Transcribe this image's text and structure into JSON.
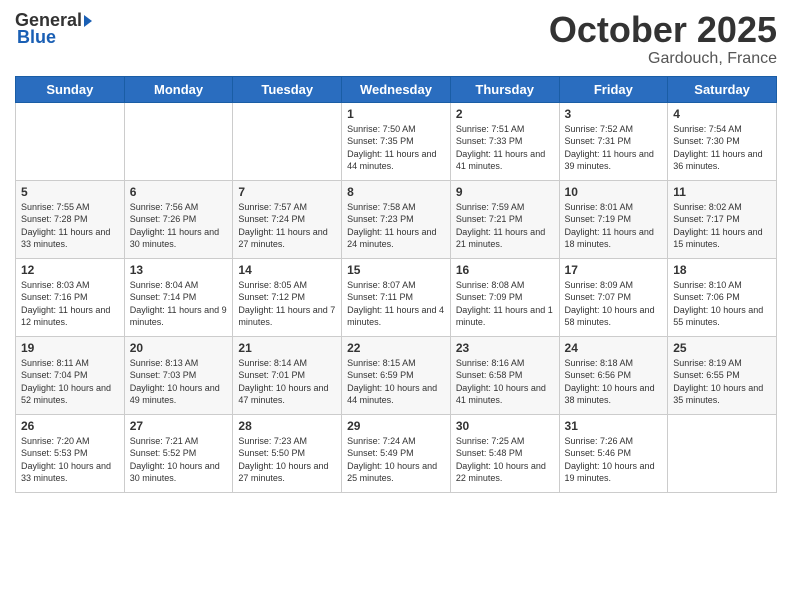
{
  "header": {
    "logo_general": "General",
    "logo_blue": "Blue",
    "month_title": "October 2025",
    "location": "Gardouch, France"
  },
  "calendar": {
    "days_of_week": [
      "Sunday",
      "Monday",
      "Tuesday",
      "Wednesday",
      "Thursday",
      "Friday",
      "Saturday"
    ],
    "weeks": [
      [
        {
          "day": "",
          "info": ""
        },
        {
          "day": "",
          "info": ""
        },
        {
          "day": "",
          "info": ""
        },
        {
          "day": "1",
          "info": "Sunrise: 7:50 AM\nSunset: 7:35 PM\nDaylight: 11 hours and 44 minutes."
        },
        {
          "day": "2",
          "info": "Sunrise: 7:51 AM\nSunset: 7:33 PM\nDaylight: 11 hours and 41 minutes."
        },
        {
          "day": "3",
          "info": "Sunrise: 7:52 AM\nSunset: 7:31 PM\nDaylight: 11 hours and 39 minutes."
        },
        {
          "day": "4",
          "info": "Sunrise: 7:54 AM\nSunset: 7:30 PM\nDaylight: 11 hours and 36 minutes."
        }
      ],
      [
        {
          "day": "5",
          "info": "Sunrise: 7:55 AM\nSunset: 7:28 PM\nDaylight: 11 hours and 33 minutes."
        },
        {
          "day": "6",
          "info": "Sunrise: 7:56 AM\nSunset: 7:26 PM\nDaylight: 11 hours and 30 minutes."
        },
        {
          "day": "7",
          "info": "Sunrise: 7:57 AM\nSunset: 7:24 PM\nDaylight: 11 hours and 27 minutes."
        },
        {
          "day": "8",
          "info": "Sunrise: 7:58 AM\nSunset: 7:23 PM\nDaylight: 11 hours and 24 minutes."
        },
        {
          "day": "9",
          "info": "Sunrise: 7:59 AM\nSunset: 7:21 PM\nDaylight: 11 hours and 21 minutes."
        },
        {
          "day": "10",
          "info": "Sunrise: 8:01 AM\nSunset: 7:19 PM\nDaylight: 11 hours and 18 minutes."
        },
        {
          "day": "11",
          "info": "Sunrise: 8:02 AM\nSunset: 7:17 PM\nDaylight: 11 hours and 15 minutes."
        }
      ],
      [
        {
          "day": "12",
          "info": "Sunrise: 8:03 AM\nSunset: 7:16 PM\nDaylight: 11 hours and 12 minutes."
        },
        {
          "day": "13",
          "info": "Sunrise: 8:04 AM\nSunset: 7:14 PM\nDaylight: 11 hours and 9 minutes."
        },
        {
          "day": "14",
          "info": "Sunrise: 8:05 AM\nSunset: 7:12 PM\nDaylight: 11 hours and 7 minutes."
        },
        {
          "day": "15",
          "info": "Sunrise: 8:07 AM\nSunset: 7:11 PM\nDaylight: 11 hours and 4 minutes."
        },
        {
          "day": "16",
          "info": "Sunrise: 8:08 AM\nSunset: 7:09 PM\nDaylight: 11 hours and 1 minute."
        },
        {
          "day": "17",
          "info": "Sunrise: 8:09 AM\nSunset: 7:07 PM\nDaylight: 10 hours and 58 minutes."
        },
        {
          "day": "18",
          "info": "Sunrise: 8:10 AM\nSunset: 7:06 PM\nDaylight: 10 hours and 55 minutes."
        }
      ],
      [
        {
          "day": "19",
          "info": "Sunrise: 8:11 AM\nSunset: 7:04 PM\nDaylight: 10 hours and 52 minutes."
        },
        {
          "day": "20",
          "info": "Sunrise: 8:13 AM\nSunset: 7:03 PM\nDaylight: 10 hours and 49 minutes."
        },
        {
          "day": "21",
          "info": "Sunrise: 8:14 AM\nSunset: 7:01 PM\nDaylight: 10 hours and 47 minutes."
        },
        {
          "day": "22",
          "info": "Sunrise: 8:15 AM\nSunset: 6:59 PM\nDaylight: 10 hours and 44 minutes."
        },
        {
          "day": "23",
          "info": "Sunrise: 8:16 AM\nSunset: 6:58 PM\nDaylight: 10 hours and 41 minutes."
        },
        {
          "day": "24",
          "info": "Sunrise: 8:18 AM\nSunset: 6:56 PM\nDaylight: 10 hours and 38 minutes."
        },
        {
          "day": "25",
          "info": "Sunrise: 8:19 AM\nSunset: 6:55 PM\nDaylight: 10 hours and 35 minutes."
        }
      ],
      [
        {
          "day": "26",
          "info": "Sunrise: 7:20 AM\nSunset: 5:53 PM\nDaylight: 10 hours and 33 minutes."
        },
        {
          "day": "27",
          "info": "Sunrise: 7:21 AM\nSunset: 5:52 PM\nDaylight: 10 hours and 30 minutes."
        },
        {
          "day": "28",
          "info": "Sunrise: 7:23 AM\nSunset: 5:50 PM\nDaylight: 10 hours and 27 minutes."
        },
        {
          "day": "29",
          "info": "Sunrise: 7:24 AM\nSunset: 5:49 PM\nDaylight: 10 hours and 25 minutes."
        },
        {
          "day": "30",
          "info": "Sunrise: 7:25 AM\nSunset: 5:48 PM\nDaylight: 10 hours and 22 minutes."
        },
        {
          "day": "31",
          "info": "Sunrise: 7:26 AM\nSunset: 5:46 PM\nDaylight: 10 hours and 19 minutes."
        },
        {
          "day": "",
          "info": ""
        }
      ]
    ]
  }
}
